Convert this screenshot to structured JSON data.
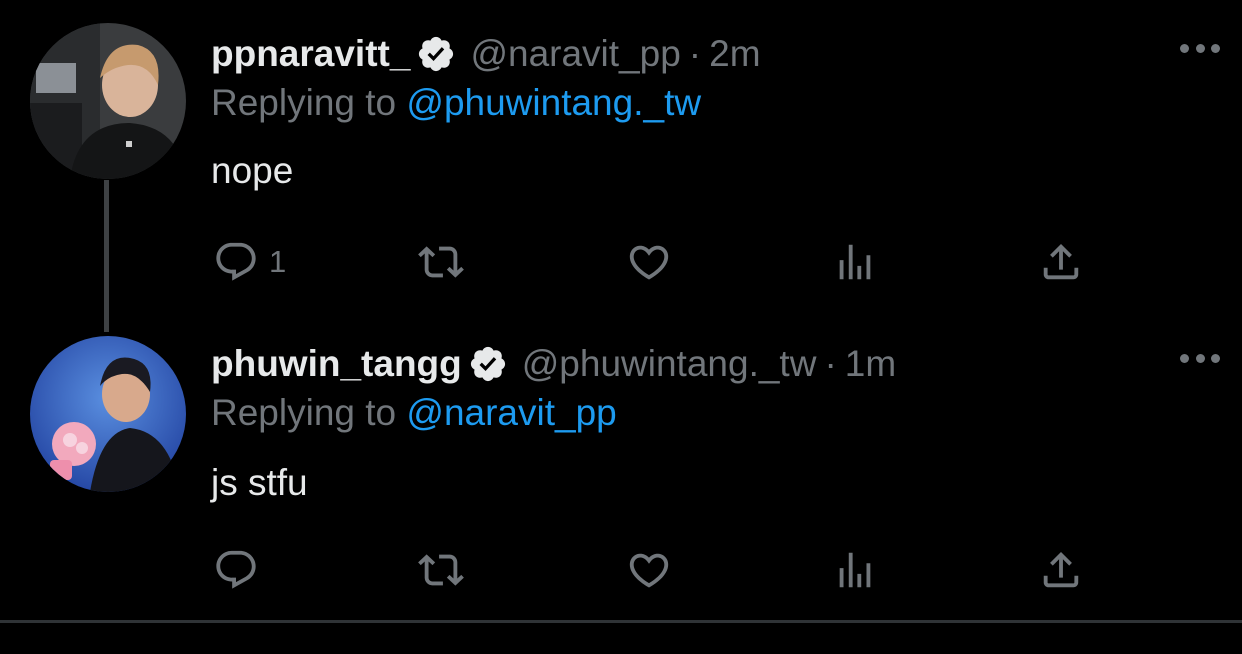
{
  "tweets": [
    {
      "display_name": "ppnaravitt_",
      "handle": "@naravit_pp",
      "separator": "·",
      "time": "2m",
      "replying_prefix": "Replying to",
      "replying_to": "@phuwintang._tw",
      "text": "nope",
      "reply_count": "1",
      "verified": true
    },
    {
      "display_name": "phuwin_tangg",
      "handle": "@phuwintang._tw",
      "separator": "·",
      "time": "1m",
      "replying_prefix": "Replying to",
      "replying_to": "@naravit_pp",
      "text": "js stfu",
      "reply_count": "",
      "verified": true
    }
  ],
  "icons": {
    "reply": "reply-icon",
    "retweet": "retweet-icon",
    "like": "like-icon",
    "views": "views-icon",
    "share": "share-icon",
    "more": "more-icon",
    "verified": "verified-badge-icon"
  },
  "colors": {
    "background": "#000000",
    "primary_text": "#e7e9ea",
    "secondary_text": "#71767b",
    "link": "#1d9bf0",
    "thread_line": "#3e4144",
    "divider": "#2f3336"
  }
}
